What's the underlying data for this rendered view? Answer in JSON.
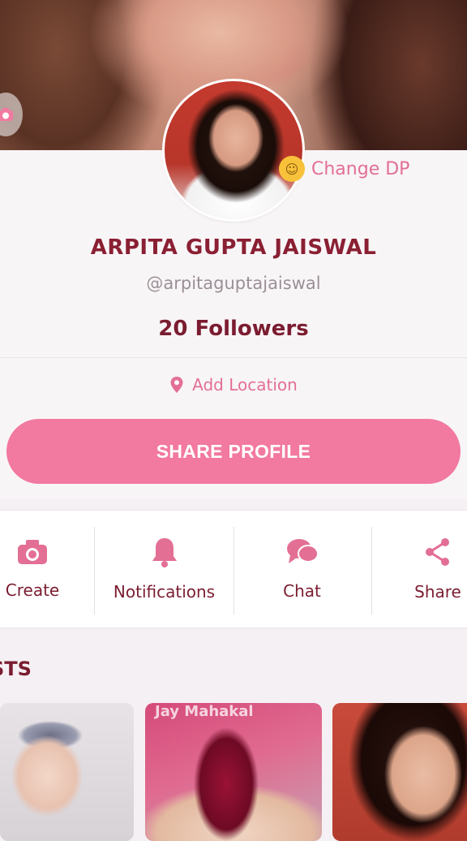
{
  "profile": {
    "change_dp_label": "Change DP",
    "name": "ARPITA GUPTA JAISWAL",
    "handle": "@arpitaguptajaiswal",
    "followers": "20 Followers",
    "add_location_label": "Add Location",
    "share_profile_label": "SHARE PROFILE"
  },
  "actions": [
    {
      "label": "Create",
      "icon": "camera-icon"
    },
    {
      "label": "Notifications",
      "icon": "bell-icon"
    },
    {
      "label": "Chat",
      "icon": "chat-icon"
    },
    {
      "label": "Share",
      "icon": "share-icon"
    }
  ],
  "posts": {
    "section_title": "STS",
    "thumb2_overlay_text": "Jay Mahakal"
  },
  "colors": {
    "accent_pink": "#f2799f",
    "text_maroon": "#7b1c30",
    "label_pink": "#e36f95"
  }
}
